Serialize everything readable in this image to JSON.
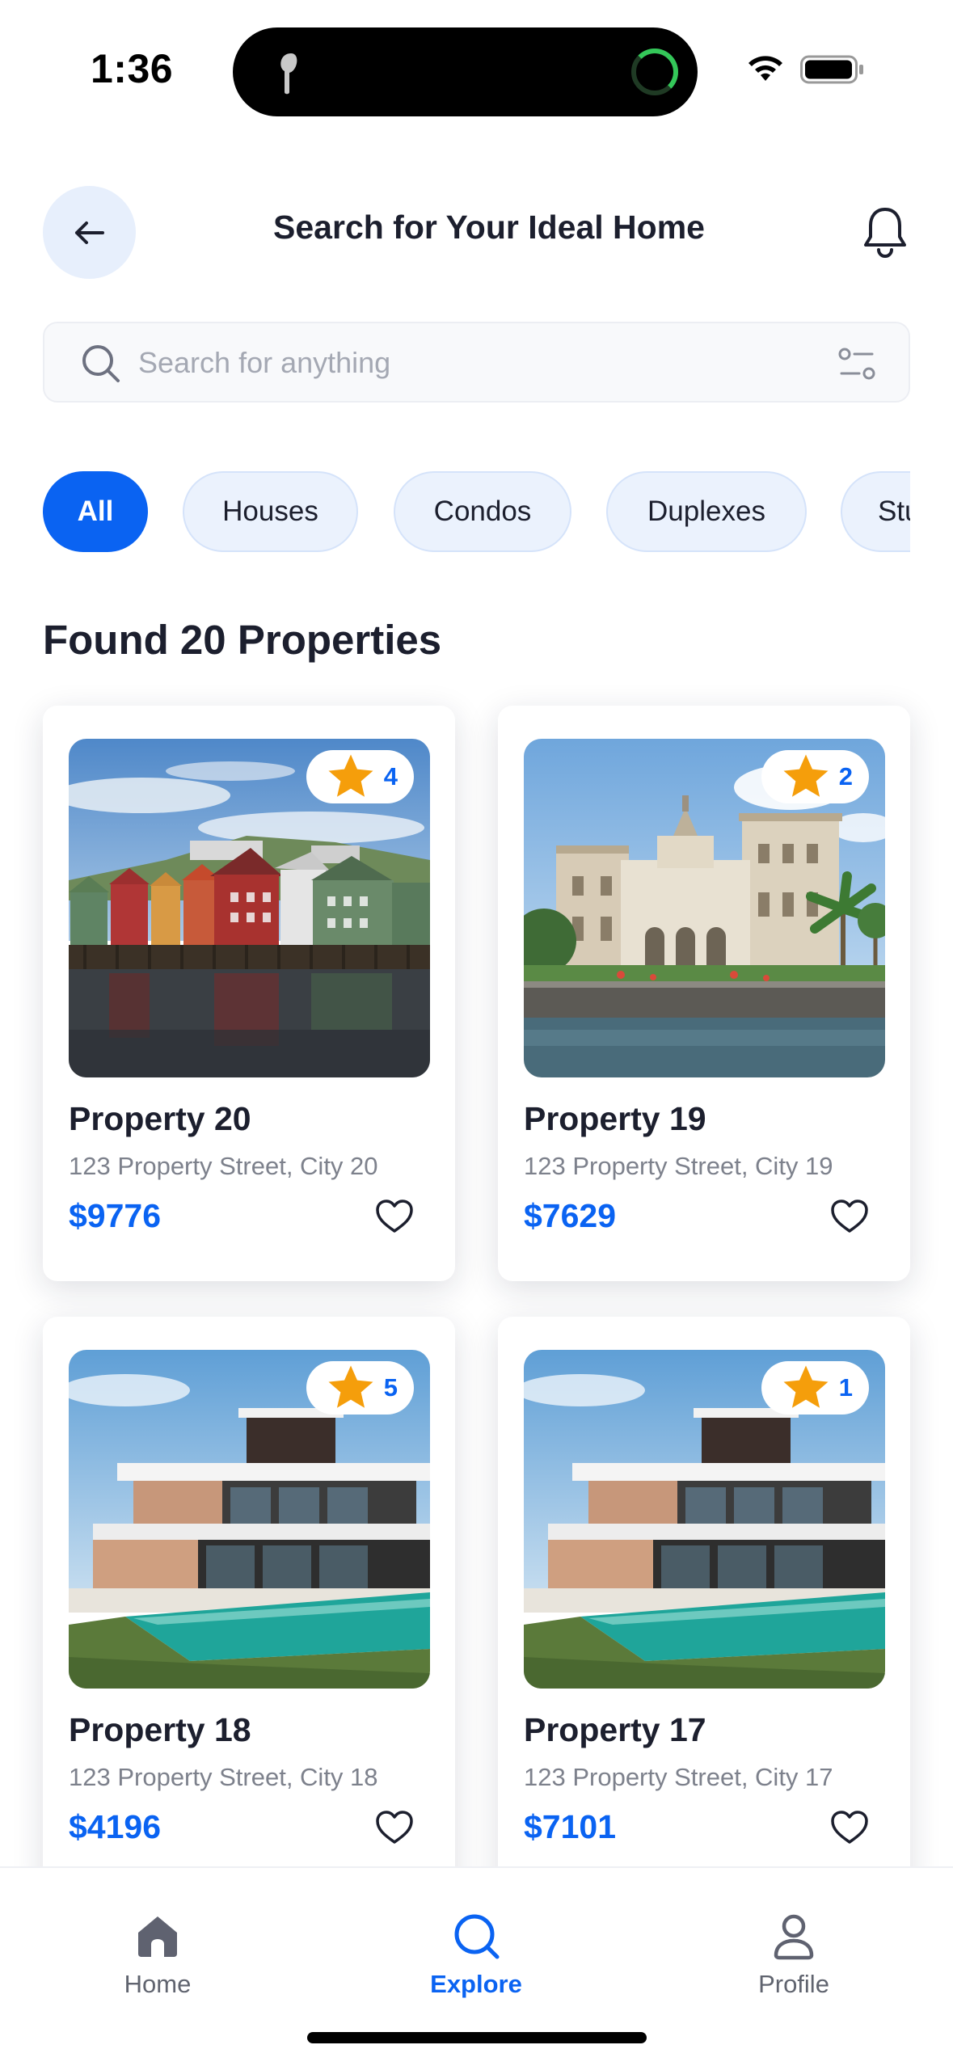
{
  "status_bar": {
    "time": "1:36"
  },
  "header": {
    "title": "Search for Your Ideal Home"
  },
  "search": {
    "placeholder": "Search for anything",
    "value": ""
  },
  "categories": [
    {
      "label": "All",
      "active": true
    },
    {
      "label": "Houses",
      "active": false
    },
    {
      "label": "Condos",
      "active": false
    },
    {
      "label": "Duplexes",
      "active": false
    },
    {
      "label": "Studios",
      "active": false
    }
  ],
  "results": {
    "heading": "Found 20 Properties"
  },
  "properties": [
    {
      "name": "Property 20",
      "address": "123 Property Street, City 20",
      "price": "$9776",
      "rating": "4",
      "photo": "waterfront-houses"
    },
    {
      "name": "Property 19",
      "address": "123 Property Street, City 19",
      "price": "$7629",
      "rating": "2",
      "photo": "mansion-by-water"
    },
    {
      "name": "Property 18",
      "address": "123 Property Street, City 18",
      "price": "$4196",
      "rating": "5",
      "photo": "modern-villa-pool"
    },
    {
      "name": "Property 17",
      "address": "123 Property Street, City 17",
      "price": "$7101",
      "rating": "1",
      "photo": "modern-villa-pool"
    }
  ],
  "bottom_nav": [
    {
      "label": "Home",
      "icon": "home-icon",
      "active": false
    },
    {
      "label": "Explore",
      "icon": "search-icon",
      "active": true
    },
    {
      "label": "Profile",
      "icon": "person-icon",
      "active": false
    }
  ],
  "colors": {
    "accent": "#0a63f2",
    "chip_bg": "#ebf2fd",
    "star": "#f59e0b",
    "text": "#1c1f2e",
    "muted": "#7d818c"
  }
}
